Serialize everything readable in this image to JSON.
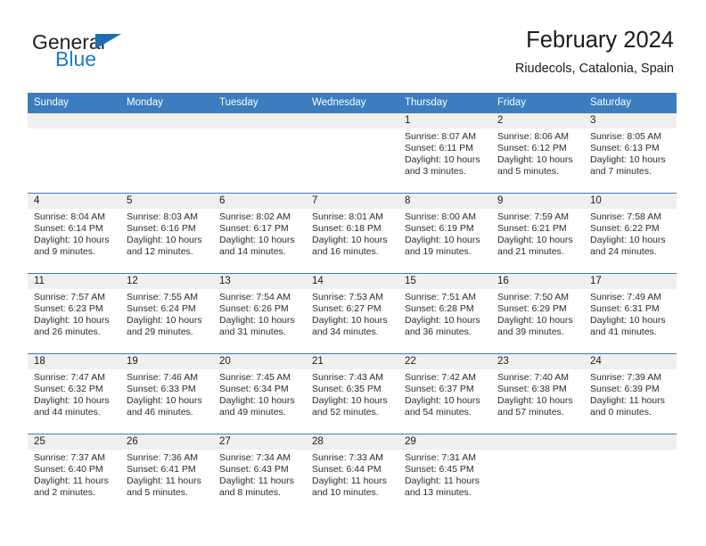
{
  "brand": {
    "line1": "General",
    "line2": "Blue",
    "accent_color": "#1f7ac4",
    "triangle_color": "#1f6db5"
  },
  "header": {
    "title": "February 2024",
    "subtitle": "Riudecols, Catalonia, Spain"
  },
  "theme": {
    "header_bar": "#3b7dbf",
    "day_number_band": "#efefef",
    "cell_background": "#ffffff",
    "text": "#1b1b1b"
  },
  "weekdays": [
    "Sunday",
    "Monday",
    "Tuesday",
    "Wednesday",
    "Thursday",
    "Friday",
    "Saturday"
  ],
  "weeks": [
    {
      "days": [
        {
          "number": "",
          "sunrise": "",
          "sunset": "",
          "daylight_1": "",
          "daylight_2": ""
        },
        {
          "number": "",
          "sunrise": "",
          "sunset": "",
          "daylight_1": "",
          "daylight_2": ""
        },
        {
          "number": "",
          "sunrise": "",
          "sunset": "",
          "daylight_1": "",
          "daylight_2": ""
        },
        {
          "number": "",
          "sunrise": "",
          "sunset": "",
          "daylight_1": "",
          "daylight_2": ""
        },
        {
          "number": "1",
          "sunrise": "Sunrise: 8:07 AM",
          "sunset": "Sunset: 6:11 PM",
          "daylight_1": "Daylight: 10 hours",
          "daylight_2": "and 3 minutes."
        },
        {
          "number": "2",
          "sunrise": "Sunrise: 8:06 AM",
          "sunset": "Sunset: 6:12 PM",
          "daylight_1": "Daylight: 10 hours",
          "daylight_2": "and 5 minutes."
        },
        {
          "number": "3",
          "sunrise": "Sunrise: 8:05 AM",
          "sunset": "Sunset: 6:13 PM",
          "daylight_1": "Daylight: 10 hours",
          "daylight_2": "and 7 minutes."
        }
      ]
    },
    {
      "days": [
        {
          "number": "4",
          "sunrise": "Sunrise: 8:04 AM",
          "sunset": "Sunset: 6:14 PM",
          "daylight_1": "Daylight: 10 hours",
          "daylight_2": "and 9 minutes."
        },
        {
          "number": "5",
          "sunrise": "Sunrise: 8:03 AM",
          "sunset": "Sunset: 6:16 PM",
          "daylight_1": "Daylight: 10 hours",
          "daylight_2": "and 12 minutes."
        },
        {
          "number": "6",
          "sunrise": "Sunrise: 8:02 AM",
          "sunset": "Sunset: 6:17 PM",
          "daylight_1": "Daylight: 10 hours",
          "daylight_2": "and 14 minutes."
        },
        {
          "number": "7",
          "sunrise": "Sunrise: 8:01 AM",
          "sunset": "Sunset: 6:18 PM",
          "daylight_1": "Daylight: 10 hours",
          "daylight_2": "and 16 minutes."
        },
        {
          "number": "8",
          "sunrise": "Sunrise: 8:00 AM",
          "sunset": "Sunset: 6:19 PM",
          "daylight_1": "Daylight: 10 hours",
          "daylight_2": "and 19 minutes."
        },
        {
          "number": "9",
          "sunrise": "Sunrise: 7:59 AM",
          "sunset": "Sunset: 6:21 PM",
          "daylight_1": "Daylight: 10 hours",
          "daylight_2": "and 21 minutes."
        },
        {
          "number": "10",
          "sunrise": "Sunrise: 7:58 AM",
          "sunset": "Sunset: 6:22 PM",
          "daylight_1": "Daylight: 10 hours",
          "daylight_2": "and 24 minutes."
        }
      ]
    },
    {
      "days": [
        {
          "number": "11",
          "sunrise": "Sunrise: 7:57 AM",
          "sunset": "Sunset: 6:23 PM",
          "daylight_1": "Daylight: 10 hours",
          "daylight_2": "and 26 minutes."
        },
        {
          "number": "12",
          "sunrise": "Sunrise: 7:55 AM",
          "sunset": "Sunset: 6:24 PM",
          "daylight_1": "Daylight: 10 hours",
          "daylight_2": "and 29 minutes."
        },
        {
          "number": "13",
          "sunrise": "Sunrise: 7:54 AM",
          "sunset": "Sunset: 6:26 PM",
          "daylight_1": "Daylight: 10 hours",
          "daylight_2": "and 31 minutes."
        },
        {
          "number": "14",
          "sunrise": "Sunrise: 7:53 AM",
          "sunset": "Sunset: 6:27 PM",
          "daylight_1": "Daylight: 10 hours",
          "daylight_2": "and 34 minutes."
        },
        {
          "number": "15",
          "sunrise": "Sunrise: 7:51 AM",
          "sunset": "Sunset: 6:28 PM",
          "daylight_1": "Daylight: 10 hours",
          "daylight_2": "and 36 minutes."
        },
        {
          "number": "16",
          "sunrise": "Sunrise: 7:50 AM",
          "sunset": "Sunset: 6:29 PM",
          "daylight_1": "Daylight: 10 hours",
          "daylight_2": "and 39 minutes."
        },
        {
          "number": "17",
          "sunrise": "Sunrise: 7:49 AM",
          "sunset": "Sunset: 6:31 PM",
          "daylight_1": "Daylight: 10 hours",
          "daylight_2": "and 41 minutes."
        }
      ]
    },
    {
      "days": [
        {
          "number": "18",
          "sunrise": "Sunrise: 7:47 AM",
          "sunset": "Sunset: 6:32 PM",
          "daylight_1": "Daylight: 10 hours",
          "daylight_2": "and 44 minutes."
        },
        {
          "number": "19",
          "sunrise": "Sunrise: 7:46 AM",
          "sunset": "Sunset: 6:33 PM",
          "daylight_1": "Daylight: 10 hours",
          "daylight_2": "and 46 minutes."
        },
        {
          "number": "20",
          "sunrise": "Sunrise: 7:45 AM",
          "sunset": "Sunset: 6:34 PM",
          "daylight_1": "Daylight: 10 hours",
          "daylight_2": "and 49 minutes."
        },
        {
          "number": "21",
          "sunrise": "Sunrise: 7:43 AM",
          "sunset": "Sunset: 6:35 PM",
          "daylight_1": "Daylight: 10 hours",
          "daylight_2": "and 52 minutes."
        },
        {
          "number": "22",
          "sunrise": "Sunrise: 7:42 AM",
          "sunset": "Sunset: 6:37 PM",
          "daylight_1": "Daylight: 10 hours",
          "daylight_2": "and 54 minutes."
        },
        {
          "number": "23",
          "sunrise": "Sunrise: 7:40 AM",
          "sunset": "Sunset: 6:38 PM",
          "daylight_1": "Daylight: 10 hours",
          "daylight_2": "and 57 minutes."
        },
        {
          "number": "24",
          "sunrise": "Sunrise: 7:39 AM",
          "sunset": "Sunset: 6:39 PM",
          "daylight_1": "Daylight: 11 hours",
          "daylight_2": "and 0 minutes."
        }
      ]
    },
    {
      "days": [
        {
          "number": "25",
          "sunrise": "Sunrise: 7:37 AM",
          "sunset": "Sunset: 6:40 PM",
          "daylight_1": "Daylight: 11 hours",
          "daylight_2": "and 2 minutes."
        },
        {
          "number": "26",
          "sunrise": "Sunrise: 7:36 AM",
          "sunset": "Sunset: 6:41 PM",
          "daylight_1": "Daylight: 11 hours",
          "daylight_2": "and 5 minutes."
        },
        {
          "number": "27",
          "sunrise": "Sunrise: 7:34 AM",
          "sunset": "Sunset: 6:43 PM",
          "daylight_1": "Daylight: 11 hours",
          "daylight_2": "and 8 minutes."
        },
        {
          "number": "28",
          "sunrise": "Sunrise: 7:33 AM",
          "sunset": "Sunset: 6:44 PM",
          "daylight_1": "Daylight: 11 hours",
          "daylight_2": "and 10 minutes."
        },
        {
          "number": "29",
          "sunrise": "Sunrise: 7:31 AM",
          "sunset": "Sunset: 6:45 PM",
          "daylight_1": "Daylight: 11 hours",
          "daylight_2": "and 13 minutes."
        },
        {
          "number": "",
          "sunrise": "",
          "sunset": "",
          "daylight_1": "",
          "daylight_2": ""
        },
        {
          "number": "",
          "sunrise": "",
          "sunset": "",
          "daylight_1": "",
          "daylight_2": ""
        }
      ]
    }
  ]
}
